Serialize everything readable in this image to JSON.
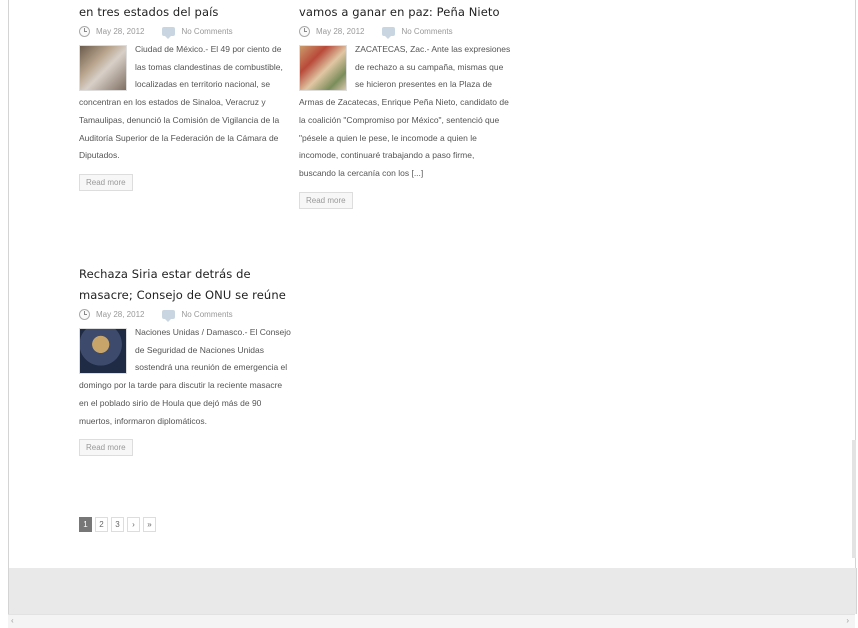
{
  "posts": [
    {
      "title": "en tres estados del país",
      "date": "May 28, 2012",
      "comments": "No Comments",
      "excerpt": "Ciudad de México.- El 49 por ciento de las tomas clandestinas de combustible, localizadas en territorio nacional, se concentran en los estados de Sinaloa, Veracruz y Tamaulipas, denunció la Comisión de Vigilancia de la Auditoría Superior de la Federación de la Cámara de Diputados.",
      "read_more": "Read more"
    },
    {
      "title": "vamos a ganar en paz: Peña Nieto",
      "date": "May 28, 2012",
      "comments": "No Comments",
      "excerpt": "ZACATECAS, Zac.- Ante las expresiones de rechazo a su campaña, mismas que se hicieron presentes en la Plaza de Armas de Zacatecas, Enrique Peña Nieto, candidato de la coalición \"Compromiso por México\", sentenció que \"pésele a quien le pese, le incomode a quien le incomode, continuaré trabajando a paso firme, buscando la cercanía con los [...]",
      "read_more": "Read more"
    },
    {
      "title": "Rechaza Siria estar detrás de masacre; Consejo de ONU se reúne",
      "date": "May 28, 2012",
      "comments": "No Comments",
      "excerpt": "Naciones Unidas / Damasco.- El Consejo de Seguridad de Naciones Unidas sostendrá una reunión de emergencia el domingo por la tarde para discutir la reciente masacre en el poblado sirio de Houla que dejó más de 90 muertos, informaron diplomáticos.",
      "read_more": "Read more"
    }
  ],
  "pagination": {
    "current": "1",
    "pages": [
      "2",
      "3"
    ],
    "next": "›",
    "last": "»"
  },
  "scrollbar": {
    "left_arrow": "‹",
    "right_arrow": "›"
  }
}
